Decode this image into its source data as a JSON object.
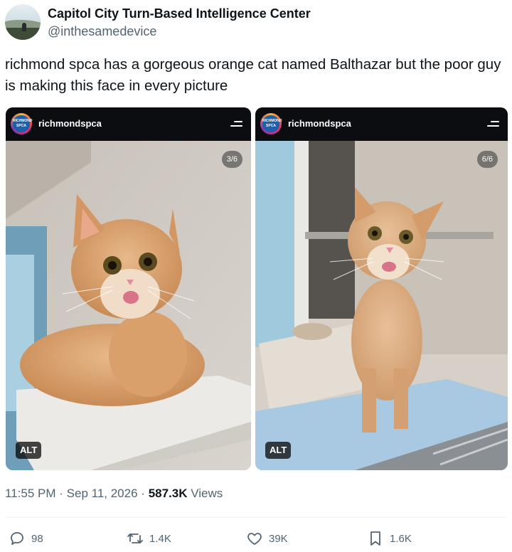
{
  "author": {
    "display_name": "Capitol City Turn-Based Intelligence Center",
    "handle": "@inthesamedevice"
  },
  "tweet": {
    "text": "richmond spca has a gorgeous orange cat named Balthazar but the poor guy is making this face in every picture"
  },
  "media": [
    {
      "account": "richmondspca",
      "logo_text": "RICHMOND SPCA",
      "counter": "3/6",
      "alt_label": "ALT"
    },
    {
      "account": "richmondspca",
      "logo_text": "RICHMOND SPCA",
      "counter": "6/6",
      "alt_label": "ALT"
    }
  ],
  "meta": {
    "time": "11:55 PM",
    "separator": "·",
    "date": "Sep 11, 2026",
    "views_count": "587.3K",
    "views_label": "Views"
  },
  "actions": {
    "replies": "98",
    "reposts": "1.4K",
    "likes": "39K",
    "bookmarks": "1.6K"
  },
  "colors": {
    "text_primary": "#0f1419",
    "text_secondary": "#536471",
    "divider": "#eff3f4"
  },
  "icons": [
    "reply-icon",
    "repost-icon",
    "like-icon",
    "bookmark-icon",
    "menu-icon"
  ]
}
